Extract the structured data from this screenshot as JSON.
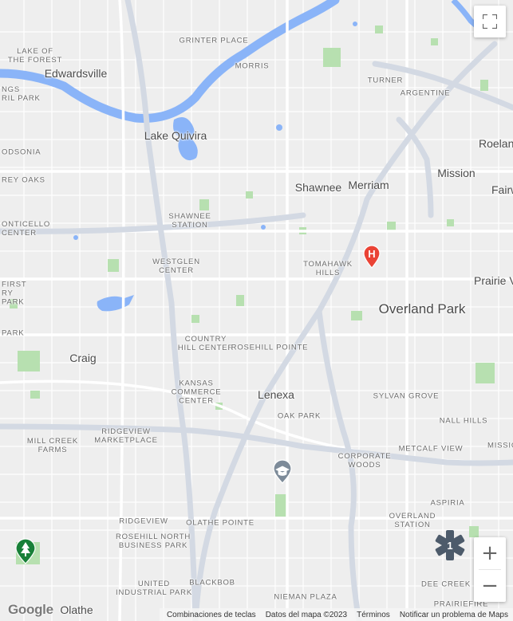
{
  "map": {
    "labels": {
      "lake_of_the_forest": "LAKE OF\nTHE FOREST",
      "edwardsville": "Edwardsville",
      "grinter_place": "GRINTER PLACE",
      "morris": "MORRIS",
      "turner": "TURNER",
      "argentine": "ARGENTINE",
      "things_rail_park": "NGS\nRIL PARK",
      "lake_quivira": "Lake Quivira",
      "roeland": "Roelan",
      "odsonia": "ODSONIA",
      "rey_oaks": "REY OAKS",
      "mission": "Mission",
      "shawnee": "Shawnee",
      "merriam": "Merriam",
      "fairway": "Fairw",
      "shawnee_station": "SHAWNEE\nSTATION",
      "monticello_center": "ONTICELLO\nCENTER",
      "tomahawk_hills": "TOMAHAWK\nHILLS",
      "westglen_center": "WESTGLEN\nCENTER",
      "first_park": "FIRST\nRY\nPARK",
      "prairie_village": "Prairie V",
      "overland_park": "Overland Park",
      "park": "PARK",
      "country_hill_center": "COUNTRY\nHILL CENTER",
      "rosehill_pointe": "ROSEHILL POINTE",
      "craig": "Craig",
      "kansas_commerce_center": "KANSAS\nCOMMERCE\nCENTER",
      "lenexa": "Lenexa",
      "sylvan_grove": "SYLVAN GROVE",
      "oak_park": "OAK PARK",
      "nall_hills": "NALL HILLS",
      "ridgeview_marketplace": "RIDGEVIEW\nMARKETPLACE",
      "mill_creek_farms": "MILL CREEK\nFARMS",
      "metcalf_view": "METCALF VIEW",
      "mission_right": "MISSIO",
      "corporate_woods": "CORPORATE\nWOODS",
      "aspiria": "ASPIRIA",
      "ridgeview": "RIDGEVIEW",
      "olathe_pointe": "OLATHE POINTE",
      "overland_station": "OVERLAND\nSTATION",
      "rosehill_north_business_park": "ROSEHILL NORTH\nBUSINESS PARK",
      "united_industrial_park": "UNITED\nINDUSTRIAL PARK",
      "blackbob": "BLACKBOB",
      "dee_creek": "DEE CREEK",
      "nieman_plaza": "NIEMAN PLAZA",
      "olathe": "Olathe",
      "prairiefire": "PRAIRIEFIRE"
    },
    "markers": {
      "hospital": {
        "label": "H",
        "color": "#ea4335",
        "icon": "hospital-pin"
      },
      "school": {
        "icon": "graduation-cap-pin",
        "color": "#7d8b99"
      },
      "park": {
        "icon": "tree-pin",
        "color": "#188038"
      },
      "medical_cluster": {
        "count": "1",
        "icon": "medical-star-icon",
        "color": "#4d5b6b"
      }
    },
    "colors": {
      "background": "#eeeeee",
      "road_major": "#ffffff",
      "highway": "#d3d9e3",
      "water": "#8ab4f8",
      "park": "#b7e0b0"
    }
  },
  "controls": {
    "fullscreen_icon": "fullscreen-icon",
    "zoom_in": "+",
    "zoom_out": "−"
  },
  "footer": {
    "brand": "Google",
    "keyboard_shortcuts": "Combinaciones de teclas",
    "map_data": "Datos del mapa ©2023",
    "terms": "Términos",
    "report": "Notificar un problema de Maps"
  }
}
